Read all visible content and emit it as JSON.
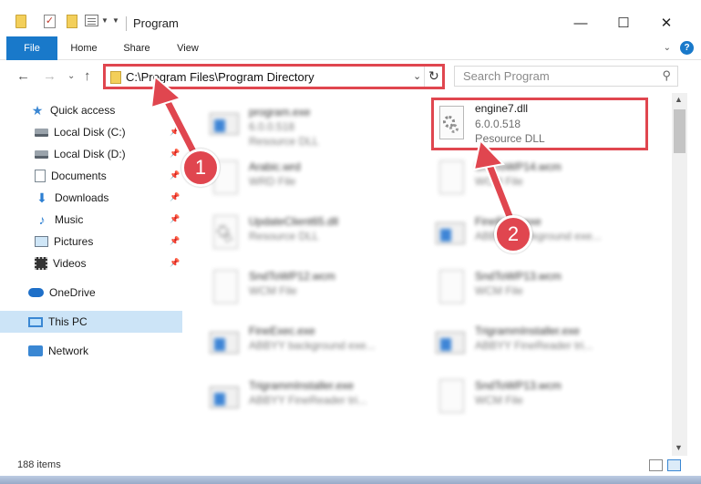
{
  "window": {
    "title": "Program",
    "minimize": "—",
    "maximize": "☐",
    "close": "✕"
  },
  "ribbon": {
    "tabs": [
      {
        "label": "File"
      },
      {
        "label": "Home"
      },
      {
        "label": "Share"
      },
      {
        "label": "View"
      }
    ],
    "help": "?"
  },
  "address": {
    "path": "C:\\Program Files\\Program Directory",
    "back": "←",
    "forward": "→",
    "up": "↑",
    "dropdown": "⌄",
    "recent": "⌄",
    "refresh": "↻"
  },
  "search": {
    "placeholder": "Search Program"
  },
  "sidebar": {
    "items": [
      {
        "label": "Quick access"
      },
      {
        "label": "Local Disk (C:)"
      },
      {
        "label": "Local Disk (D:)"
      },
      {
        "label": "Documents"
      },
      {
        "label": "Downloads"
      },
      {
        "label": "Music"
      },
      {
        "label": "Pictures"
      },
      {
        "label": "Videos"
      },
      {
        "label": "OneDrive"
      },
      {
        "label": "This PC"
      },
      {
        "label": "Network"
      }
    ]
  },
  "files": [
    {
      "name": "program.exe",
      "version": "6.0.0.518",
      "type": "Resource DLL"
    },
    {
      "name": "engine7.dll",
      "version": "6.0.0.518",
      "type": "Resource DLL"
    },
    {
      "name": "Arabic.wrd",
      "type": "WRD File"
    },
    {
      "name": "SndToWP14.wcm",
      "type": "WCM File"
    },
    {
      "name": "UpdateClient65.dll",
      "type": "Resource DLL"
    },
    {
      "name": "FineExec.exe",
      "type": "ABBYY background exe..."
    },
    {
      "name": "SndToWP12.wcm",
      "type": "WCM File"
    },
    {
      "name": "SndToWP13.wcm",
      "type": "WCM File"
    },
    {
      "name": "FineExec.exe",
      "type": "ABBYY background exe..."
    },
    {
      "name": "TrigrammInstaller.exe",
      "type": "ABBYY FineReader tri..."
    },
    {
      "name": "TrigrammInstaller.exe",
      "type": "ABBYY FineReader tri..."
    },
    {
      "name": "SndToWP13.wcm",
      "type": "WCM File"
    }
  ],
  "status": {
    "item_count": "188 items"
  },
  "annotations": {
    "step1": "1",
    "step2": "2"
  },
  "colors": {
    "accent": "#1979ca",
    "highlight": "#e0464f"
  }
}
